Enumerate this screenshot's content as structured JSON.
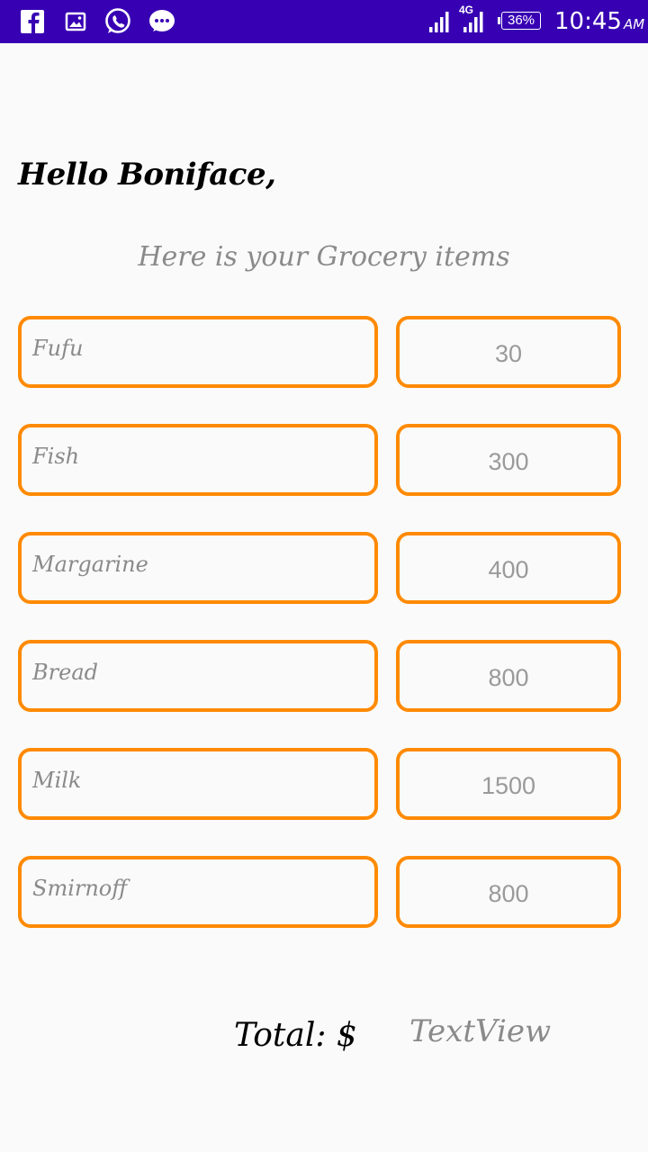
{
  "status_bar": {
    "network": "4G",
    "battery": "36%",
    "time": "10:45",
    "ampm": "AM",
    "color": "#3700b3",
    "notification_icons": [
      "facebook-icon",
      "gallery-icon",
      "whatsapp-icon",
      "message-icon"
    ]
  },
  "greeting": "Hello Boniface,",
  "subtitle": "Here is your Grocery items",
  "items": [
    {
      "name": "Fufu",
      "price": "30"
    },
    {
      "name": "Fish",
      "price": "300"
    },
    {
      "name": "Margarine",
      "price": "400"
    },
    {
      "name": "Bread",
      "price": "800"
    },
    {
      "name": "Milk",
      "price": "1500"
    },
    {
      "name": "Smirnoff",
      "price": "800"
    }
  ],
  "total": {
    "label": "Total: $",
    "value": "TextView"
  },
  "accent_color": "#ff8a00"
}
